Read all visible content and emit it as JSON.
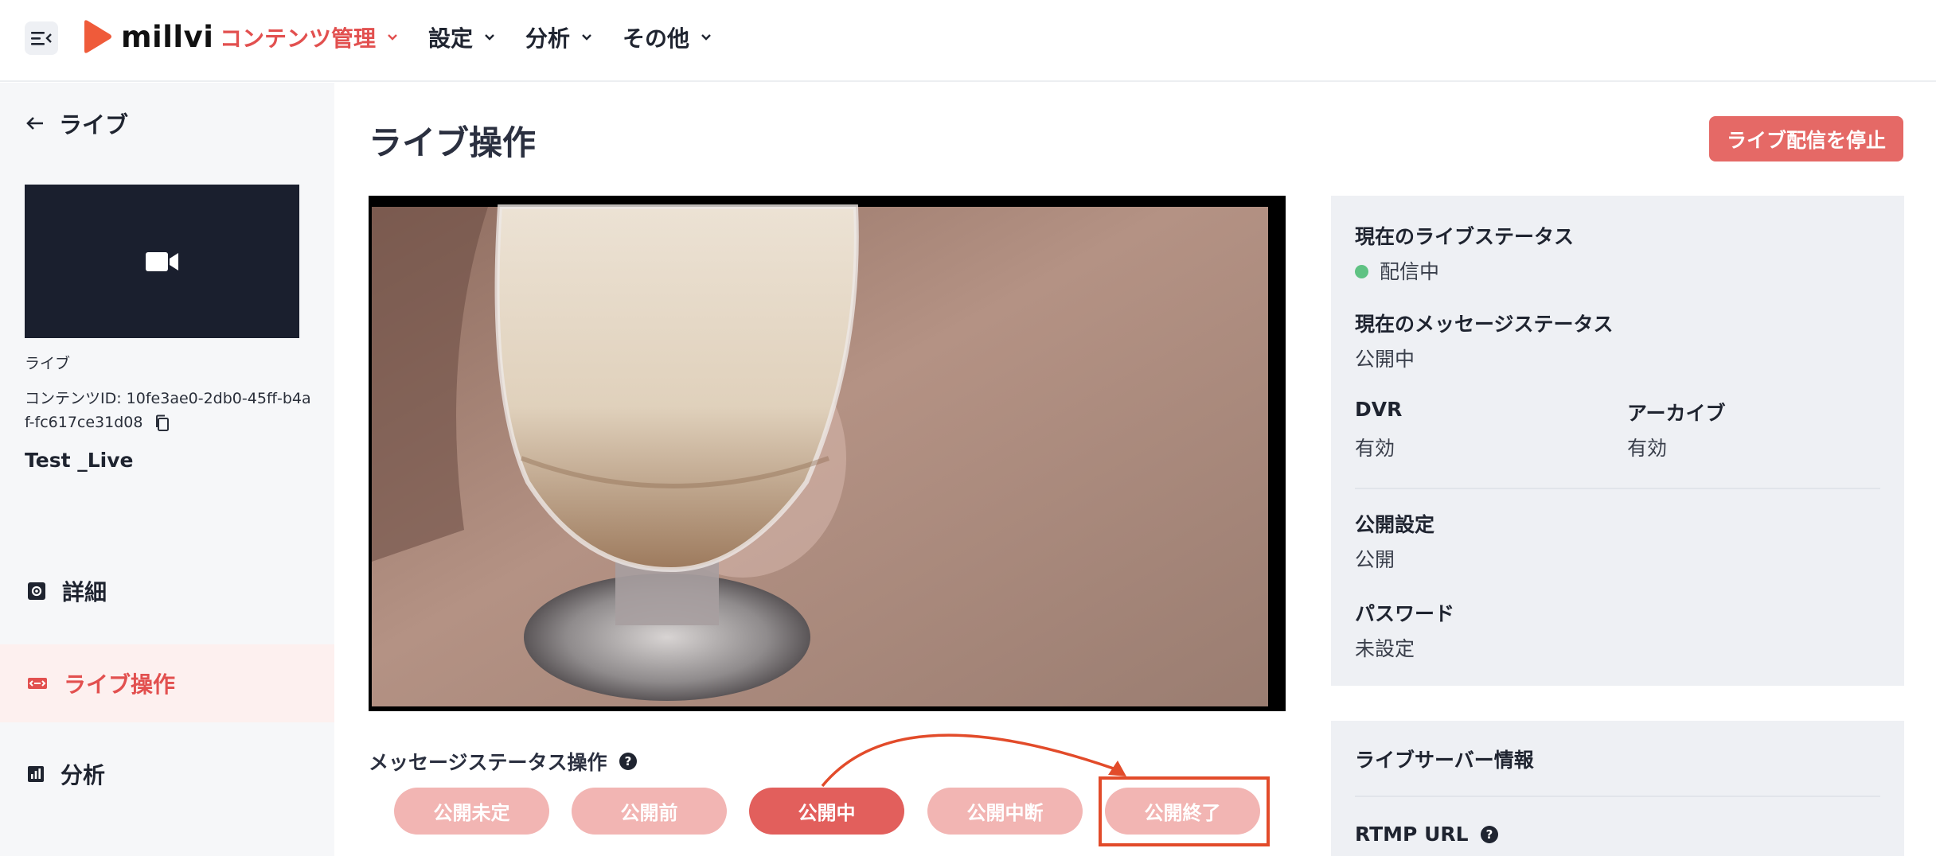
{
  "header": {
    "logo_text": "millvi",
    "nav": [
      {
        "label": "コンテンツ管理",
        "active": true
      },
      {
        "label": "設定",
        "active": false
      },
      {
        "label": "分析",
        "active": false
      },
      {
        "label": "その他",
        "active": false
      }
    ]
  },
  "sidebar": {
    "back_label": "ライブ",
    "content_type": "ライブ",
    "content_id_line": "コンテンツID: 10fe3ae0-2db0-45ff-b4af-fc617ce31d08",
    "content_title": "Test _Live",
    "items": [
      {
        "label": "詳細",
        "icon": "settings-icon"
      },
      {
        "label": "ライブ操作",
        "icon": "live-icon",
        "active": true
      },
      {
        "label": "分析",
        "icon": "chart-icon"
      }
    ]
  },
  "main": {
    "title": "ライブ操作",
    "stop_button": "ライブ配信を停止",
    "message_status_label": "メッセージステータス操作",
    "message_buttons": [
      {
        "label": "公開未定",
        "active": false
      },
      {
        "label": "公開前",
        "active": false
      },
      {
        "label": "公開中",
        "active": true
      },
      {
        "label": "公開中断",
        "active": false
      },
      {
        "label": "公開終了",
        "active": false,
        "highlighted": true
      }
    ]
  },
  "status_panel": {
    "live_status_label": "現在のライブステータス",
    "live_status_value": "配信中",
    "message_status_label": "現在のメッセージステータス",
    "message_status_value": "公開中",
    "dvr_label": "DVR",
    "dvr_value": "有効",
    "archive_label": "アーカイブ",
    "archive_value": "有効",
    "visibility_label": "公開設定",
    "visibility_value": "公開",
    "password_label": "パスワード",
    "password_value": "未設定"
  },
  "server_panel": {
    "title": "ライブサーバー情報",
    "rtmp_label": "RTMP URL"
  },
  "colors": {
    "accent": "#e2504f",
    "button_active": "#e25f5c",
    "button_faded": "#f2b5b3",
    "status_green": "#5fc283",
    "annotation": "#e24b2a"
  }
}
